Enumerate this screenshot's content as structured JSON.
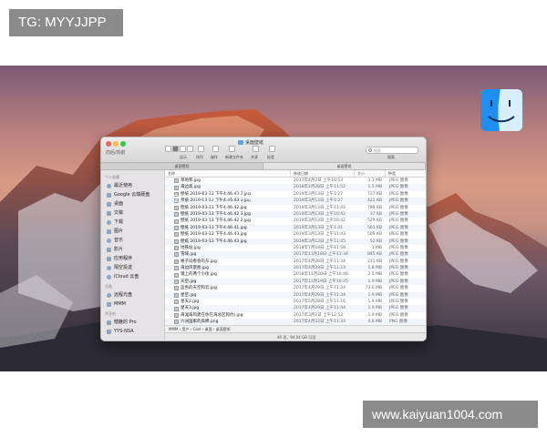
{
  "watermarks": {
    "top": "TG: MYYJJPP",
    "bottom": "www.kaiyuan1004.com"
  },
  "overlay_text": "2019-03-13 下午",
  "window": {
    "title": "桌面壁纸",
    "nav_label": "向后/向前",
    "path": "MMM › 用户 › Cool › 桌面 › 桌面壁纸",
    "status": "46 项，94.04 GB 可用"
  },
  "toolbar": {
    "view_label": "显示",
    "arrange_label": "排列",
    "action_label": "操作",
    "new_folder_label": "新建文件夹",
    "share_label": "共享",
    "tags_label": "标签",
    "search_placeholder": "搜索",
    "search_label": "搜索"
  },
  "tabs": [
    "桌面壁纸",
    "桌面壁纸"
  ],
  "sidebar": {
    "favorites_title": "个人收藏",
    "favorites": [
      "最近使用",
      "Google 云端硬盘",
      "桌面",
      "文稿",
      "下载",
      "图片",
      "音乐",
      "影片",
      "应用程序",
      "隔空投送",
      "iCloud 云盘"
    ],
    "devices_title": "设备",
    "devices": [
      "远程光盘",
      "MMM"
    ],
    "shared_title": "共享的",
    "shared": [
      "憾魅的 Pro",
      "YYS-NSA"
    ]
  },
  "file_list": {
    "columns": [
      "名称",
      "修改日期",
      "大小",
      "种类"
    ],
    "rows": [
      {
        "name": "草地和.jpg",
        "date": "2017年4月2日 上午10:53",
        "size": "3.1 MB",
        "kind": "JPEG 图像"
      },
      {
        "name": "海边高.jpg",
        "date": "2018年2月28日 上午11:52",
        "size": "1.5 MB",
        "kind": "JPEG 图像"
      },
      {
        "name": "壁纸 2019-03-13 下午4.46.43 2.jpg",
        "date": "2019年3月13日 上午1:27",
        "size": "727 KB",
        "kind": "JPEG 图像"
      },
      {
        "name": "壁纸 2019-03-13 下午4.46.43 3.jpg",
        "date": "2019年3月13日 上午1:27",
        "size": "421 KB",
        "kind": "JPEG 图像"
      },
      {
        "name": "壁纸 2019-03-13 下午4.46.42.jpg",
        "date": "2019年3月13日 上午11:42",
        "size": "798 KB",
        "kind": "JPEG 图像"
      },
      {
        "name": "壁纸 2019-03-13 下午4.46.42 3.jpg",
        "date": "2019年3月13日 上午10:42",
        "size": "37 KB",
        "kind": "JPEG 图像"
      },
      {
        "name": "壁纸 2019-03-13 下午4.46.42 2.jpg",
        "date": "2019年3月13日 上午10:42",
        "size": "529 KB",
        "kind": "JPEG 图像"
      },
      {
        "name": "壁纸 2019-03-13 下午4.46.41.jpg",
        "date": "2019年3月13日 上午1:41",
        "size": "501 KB",
        "kind": "JPEG 图像"
      },
      {
        "name": "壁纸 2019-03-13 下午4.46.43.jpg",
        "date": "2019年3月13日 上午11:43",
        "size": "509 KB",
        "kind": "JPEG 图像"
      },
      {
        "name": "壁纸 2019-03-13 下午4.46.43.jpg",
        "date": "2019年3月13日 上午11:45",
        "size": "52 KB",
        "kind": "JPEG 图像"
      },
      {
        "name": "地铁站.jpg",
        "date": "2018年7月18日 上午11:58",
        "size": "1 MB",
        "kind": "JPEG 图像"
      },
      {
        "name": "雪域.jpg",
        "date": "2017年11月18日 上午11:34",
        "size": "845 KB",
        "kind": "JPEG 图像"
      },
      {
        "name": "格子间看会的东.jpg",
        "date": "2017年4月28日 上午11:34",
        "size": "231 KB",
        "kind": "JPEG 图像"
      },
      {
        "name": "海边风景图.jpg",
        "date": "2017年4月29日 上午11:23",
        "size": "1.8 MB",
        "kind": "JPEG 图像"
      },
      {
        "name": "镜上的两个小街.jpg",
        "date": "2018年11月20日 上午10:46",
        "size": "2.5 MB",
        "kind": "JPEG 图像"
      },
      {
        "name": "天空.jpg",
        "date": "2017年11月19日 上午10:25",
        "size": "1.9 MB",
        "kind": "JPEG 图像"
      },
      {
        "name": "蓝色的天空和云.jpg",
        "date": "2017年4月29日 上午11:34",
        "size": "73.6 MB",
        "kind": "JPEG 图像"
      },
      {
        "name": "星空.jpg",
        "date": "2017年4月29日 上午11:34",
        "size": "1.9 MB",
        "kind": "JPEG 图像"
      },
      {
        "name": "星天2.jpg",
        "date": "2017年5月28日 上午11:16",
        "size": "1.9 MB",
        "kind": "JPEG 图像"
      },
      {
        "name": "星天3.jpg",
        "date": "2017年4月29日 上午11:44",
        "size": "1.9 MB",
        "kind": "JPEG 图像"
      },
      {
        "name": "海滩海风建在你在海总区和约).jpg",
        "date": "2017年3月1日 上午12:53",
        "size": "1.9 MB",
        "kind": "JPEG 图像"
      },
      {
        "name": "六洲国家的高棉.png",
        "date": "2017年4月22日 上午11:33",
        "size": "4.6 MB",
        "kind": "PNG 图像"
      }
    ]
  }
}
